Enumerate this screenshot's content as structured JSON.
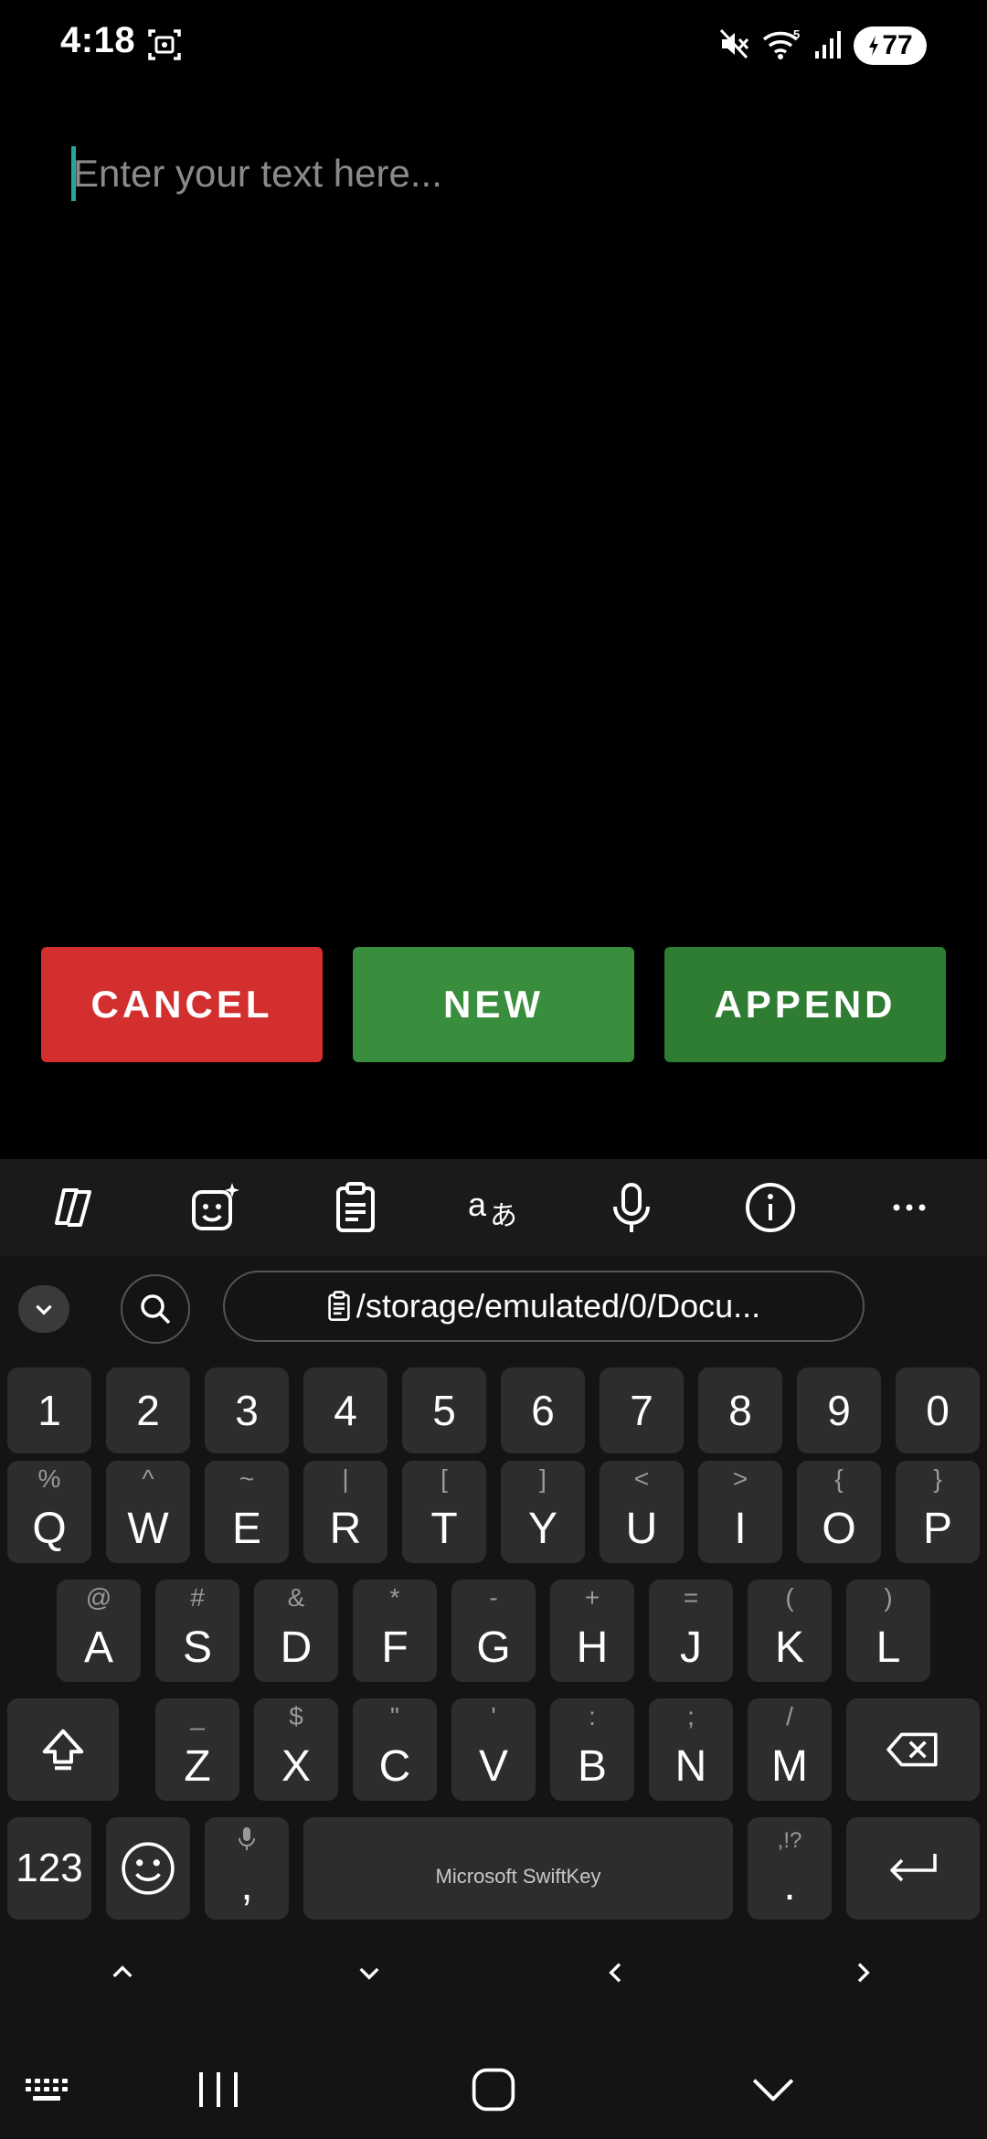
{
  "status_bar": {
    "time": "4:18",
    "battery_level": "77",
    "icons": [
      "screenshot-icon",
      "mute-icon",
      "wifi-icon",
      "signal-icon",
      "battery-icon"
    ]
  },
  "editor": {
    "placeholder": "Enter your text here...",
    "caret_color": "#26a69a"
  },
  "buttons": {
    "cancel": {
      "label": "CANCEL",
      "color": "#d32f2f"
    },
    "new": {
      "label": "NEW",
      "color": "#388e3c"
    },
    "append": {
      "label": "APPEND",
      "color": "#2e7d32"
    }
  },
  "keyboard": {
    "toolbar_icons": [
      "copilot-icon",
      "sticker-icon",
      "clipboard-icon",
      "translate-icon",
      "microphone-icon",
      "info-icon",
      "more-icon"
    ],
    "clipboard_suggestion": "/storage/emulated/0/Docu...",
    "number_row": [
      "1",
      "2",
      "3",
      "4",
      "5",
      "6",
      "7",
      "8",
      "9",
      "0"
    ],
    "row1": [
      {
        "main": "Q",
        "sec": "%"
      },
      {
        "main": "W",
        "sec": "^"
      },
      {
        "main": "E",
        "sec": "~"
      },
      {
        "main": "R",
        "sec": "|"
      },
      {
        "main": "T",
        "sec": "["
      },
      {
        "main": "Y",
        "sec": "]"
      },
      {
        "main": "U",
        "sec": "<"
      },
      {
        "main": "I",
        "sec": ">"
      },
      {
        "main": "O",
        "sec": "{"
      },
      {
        "main": "P",
        "sec": "}"
      }
    ],
    "row2": [
      {
        "main": "A",
        "sec": "@"
      },
      {
        "main": "S",
        "sec": "#"
      },
      {
        "main": "D",
        "sec": "&"
      },
      {
        "main": "F",
        "sec": "*"
      },
      {
        "main": "G",
        "sec": "-"
      },
      {
        "main": "H",
        "sec": "+"
      },
      {
        "main": "J",
        "sec": "="
      },
      {
        "main": "K",
        "sec": "("
      },
      {
        "main": "L",
        "sec": ")"
      }
    ],
    "row3": [
      {
        "main": "Z",
        "sec": "_"
      },
      {
        "main": "X",
        "sec": "$"
      },
      {
        "main": "C",
        "sec": "\""
      },
      {
        "main": "V",
        "sec": "'"
      },
      {
        "main": "B",
        "sec": ":"
      },
      {
        "main": "N",
        "sec": ";"
      },
      {
        "main": "M",
        "sec": "/"
      }
    ],
    "symbols_label": "123",
    "comma": ",",
    "space_label": "Microsoft SwiftKey",
    "period": ".",
    "period_sec": ",!?"
  }
}
